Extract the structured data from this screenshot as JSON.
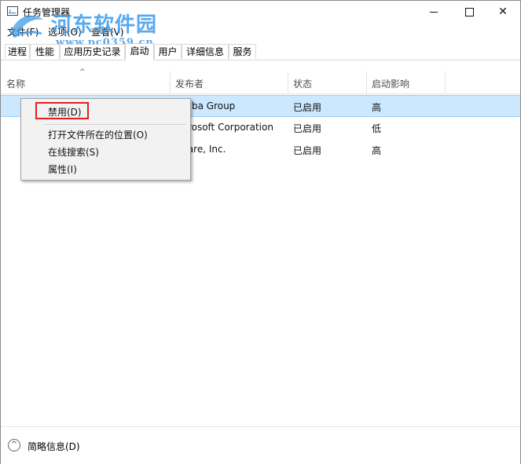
{
  "window": {
    "title": "任务管理器",
    "controls": {
      "minimize": "—",
      "close": "✕"
    }
  },
  "menubar": {
    "items": [
      "文件(F)",
      "选项(O)",
      "查看(V)"
    ]
  },
  "watermark": {
    "line1": "河东软件园",
    "line2": "www.pc0359.cn"
  },
  "tabs": [
    "进程",
    "性能",
    "应用历史记录",
    "启动",
    "用户",
    "详细信息",
    "服务"
  ],
  "active_tab": "启动",
  "columns": [
    "名称",
    "发布者",
    "状态",
    "启动影响"
  ],
  "sort_indicator": "^",
  "rows": [
    {
      "publisher": "baba Group",
      "status": "已启用",
      "impact": "高"
    },
    {
      "publisher": "icrosoft Corporation",
      "status": "已启用",
      "impact": "低"
    },
    {
      "publisher": "ware, Inc.",
      "status": "已启用",
      "impact": "高"
    }
  ],
  "context_menu": {
    "items": [
      "禁用(D)",
      "打开文件所在的位置(O)",
      "在线搜索(S)",
      "属性(I)"
    ]
  },
  "footer": {
    "label": "简略信息(D)",
    "icon": "^"
  },
  "colors": {
    "selection": "#cce8ff",
    "highlight_border": "#e02020",
    "watermark": "#3d9be9"
  }
}
